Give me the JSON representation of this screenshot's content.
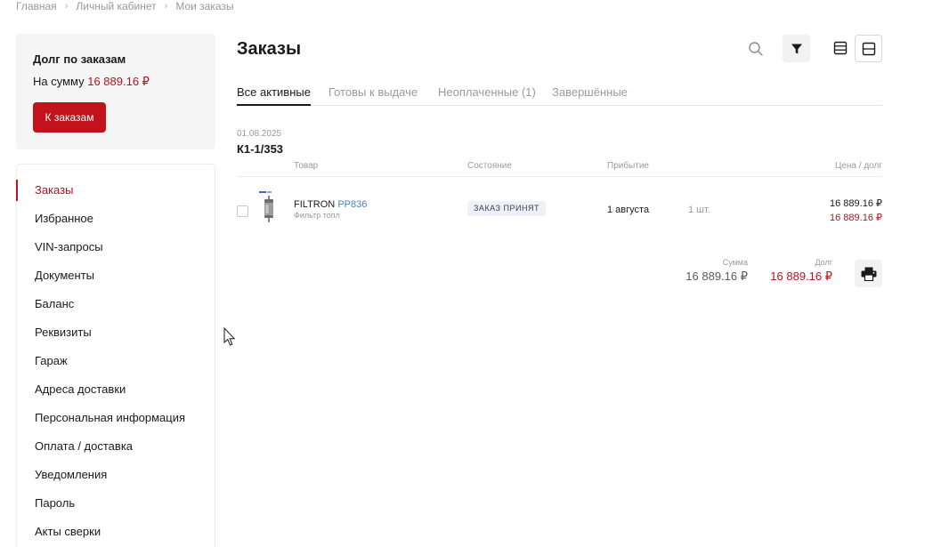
{
  "breadcrumb": {
    "items": [
      "Главная",
      "Личный кабинет",
      "Мои заказы"
    ],
    "separator": "›"
  },
  "debt_card": {
    "title": "Долг по заказам",
    "amount_prefix": "На сумму",
    "amount": "16 889.16 ₽",
    "button_label": "К заказам"
  },
  "sidebar": {
    "items": [
      {
        "label": "Заказы",
        "active": true
      },
      {
        "label": "Избранное"
      },
      {
        "label": "VIN-запросы"
      },
      {
        "label": "Документы"
      },
      {
        "label": "Баланс"
      },
      {
        "label": "Реквизиты"
      },
      {
        "label": "Гараж"
      },
      {
        "label": "Адреса доставки"
      },
      {
        "label": "Персональная информация"
      },
      {
        "label": "Оплата / доставка"
      },
      {
        "label": "Уведомления"
      },
      {
        "label": "Пароль"
      },
      {
        "label": "Акты сверки"
      }
    ]
  },
  "main": {
    "title": "Заказы",
    "toolbar_icons": [
      "search-icon",
      "filter-icon",
      "list-view-icon",
      "card-view-icon"
    ],
    "tabs": [
      {
        "label": "Все активные",
        "active": true
      },
      {
        "label": "Готовы к выдаче"
      },
      {
        "label": "Неоплаченные (1)"
      },
      {
        "label": "Завершённые"
      }
    ]
  },
  "order": {
    "date": "01.08.2025",
    "number": "К1-1/353",
    "columns": {
      "product": "Товар",
      "status": "Состояние",
      "arrival": "Прибытие",
      "price": "Цена / долг"
    },
    "item": {
      "brand": "FILTRON",
      "code": "PP836",
      "name": "Фильтр топл",
      "status": "ЗАКАЗ ПРИНЯТ",
      "arrival": "1 августа",
      "quantity": "1 шт.",
      "price": "16 889.16 ₽",
      "debt": "16 889.16 ₽"
    },
    "totals": {
      "sum_label": "Сумма",
      "sum_value": "16 889.16 ₽",
      "debt_label": "Долг",
      "debt_value": "16 889.16 ₽"
    }
  },
  "colors": {
    "accent": "#c2131c",
    "debt_text": "#b3141e",
    "link": "#4a7fc1",
    "muted": "#9a9a9a"
  }
}
